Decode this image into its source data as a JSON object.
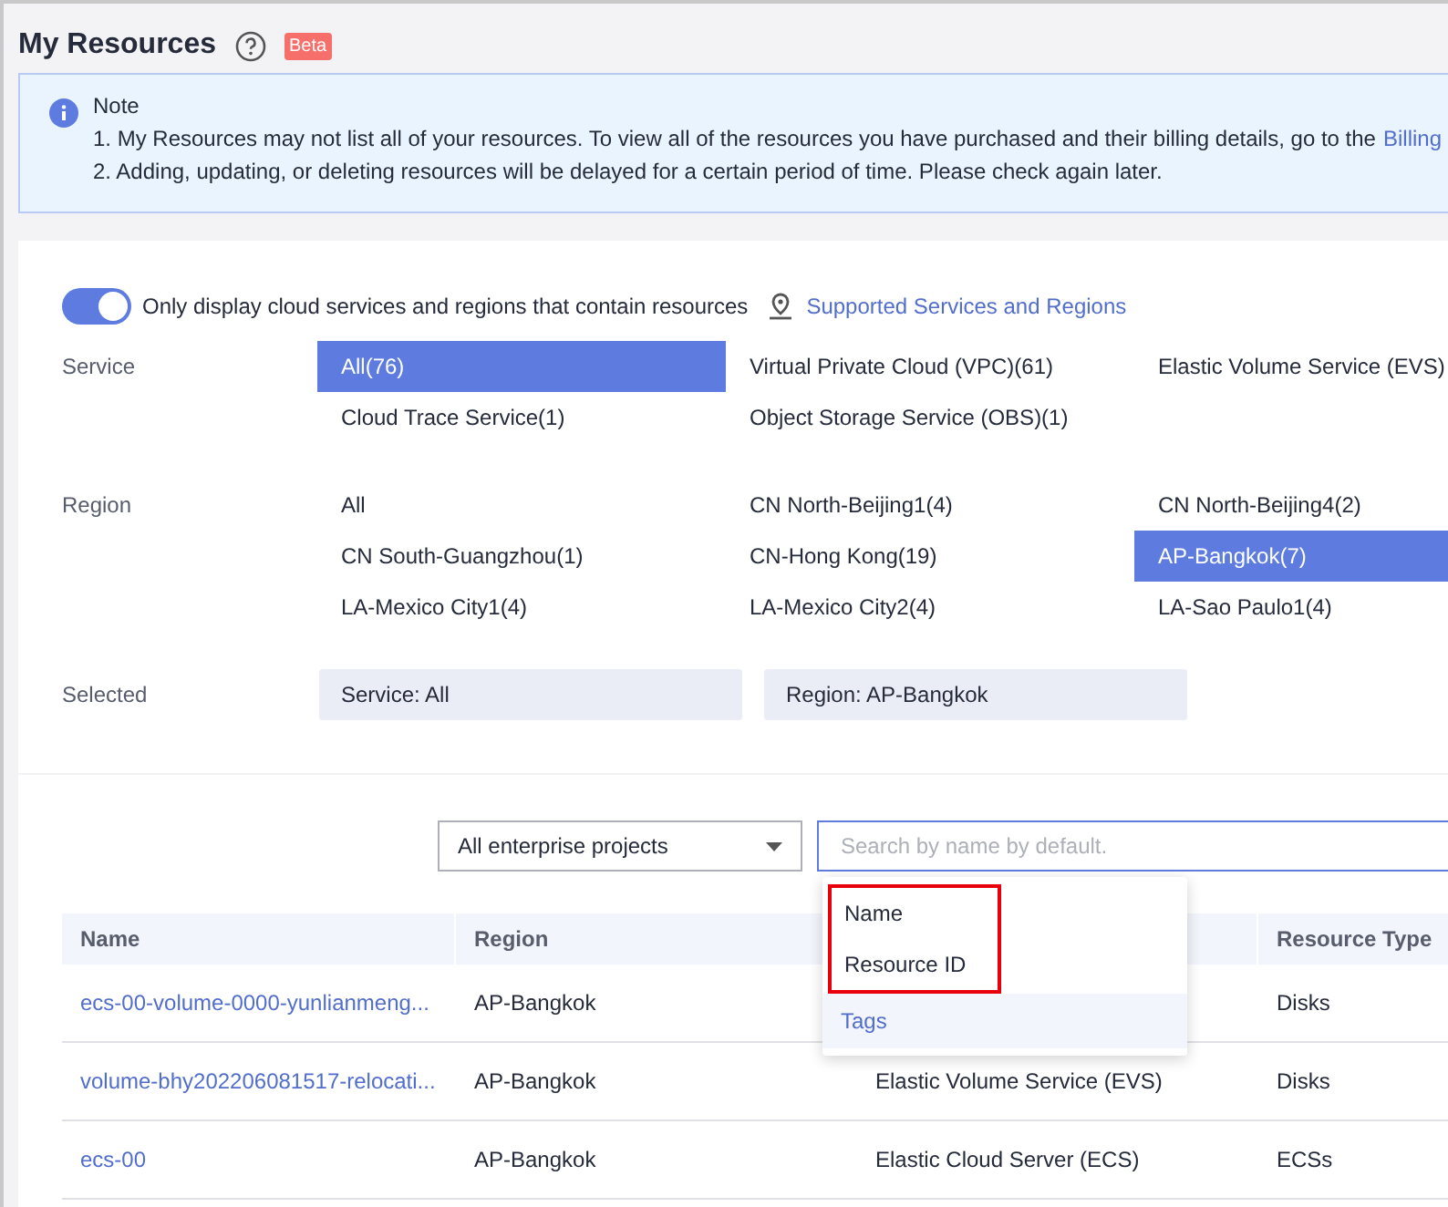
{
  "page": {
    "title": "My Resources",
    "badge": "Beta"
  },
  "note": {
    "title": "Note",
    "lines": [
      "1. My Resources may not list all of your resources. To view all of the resources you have purchased and their billing details, go to the",
      "2. Adding, updating, or deleting resources will be delayed for a certain period of time. Please check again later."
    ],
    "link": "Billing"
  },
  "filter": {
    "toggle": {
      "label": "Only display cloud services and regions that contain resources",
      "on": true
    },
    "link": "Supported Services and Regions",
    "groups": [
      {
        "label": "Service",
        "options": [
          {
            "label": "All(76)",
            "selected": true
          },
          {
            "label": "Virtual Private Cloud (VPC)(61)",
            "selected": false
          },
          {
            "label": "Elastic Volume Service (EVS)",
            "selected": false
          },
          {
            "label": "Cloud Trace Service(1)",
            "selected": false
          },
          {
            "label": "Object Storage Service (OBS)(1)",
            "selected": false
          }
        ]
      },
      {
        "label": "Region",
        "options": [
          {
            "label": "All",
            "selected": false
          },
          {
            "label": "CN North-Beijing1(4)",
            "selected": false
          },
          {
            "label": "CN North-Beijing4(2)",
            "selected": false
          },
          {
            "label": "CN South-Guangzhou(1)",
            "selected": false
          },
          {
            "label": "CN-Hong Kong(19)",
            "selected": false
          },
          {
            "label": "AP-Bangkok(7)",
            "selected": true
          },
          {
            "label": "LA-Mexico City1(4)",
            "selected": false
          },
          {
            "label": "LA-Mexico City2(4)",
            "selected": false
          },
          {
            "label": "LA-Sao Paulo1(4)",
            "selected": false
          }
        ]
      }
    ],
    "selected": {
      "label": "Selected",
      "chips": [
        "Service: All",
        "Region: AP-Bangkok"
      ]
    }
  },
  "toolbar": {
    "project_select": "All enterprise projects",
    "search": {
      "placeholder": "Search by name by default."
    },
    "menu": [
      {
        "label": "Name",
        "selected": false,
        "framed": true
      },
      {
        "label": "Resource ID",
        "selected": false,
        "framed": true
      },
      {
        "label": "Tags",
        "selected": true,
        "framed": false
      }
    ]
  },
  "table": {
    "columns": [
      "Name",
      "Region",
      "",
      "Resource Type"
    ],
    "rows": [
      {
        "name": "ecs-00-volume-0000-yunlianmeng...",
        "region": "AP-Bangkok",
        "service": "",
        "type": "Disks"
      },
      {
        "name": "volume-bhy202206081517-relocati...",
        "region": "AP-Bangkok",
        "service": "Elastic Volume Service (EVS)",
        "type": "Disks"
      },
      {
        "name": "ecs-00",
        "region": "AP-Bangkok",
        "service": "Elastic Cloud Server (ECS)",
        "type": "ECSs"
      }
    ]
  }
}
